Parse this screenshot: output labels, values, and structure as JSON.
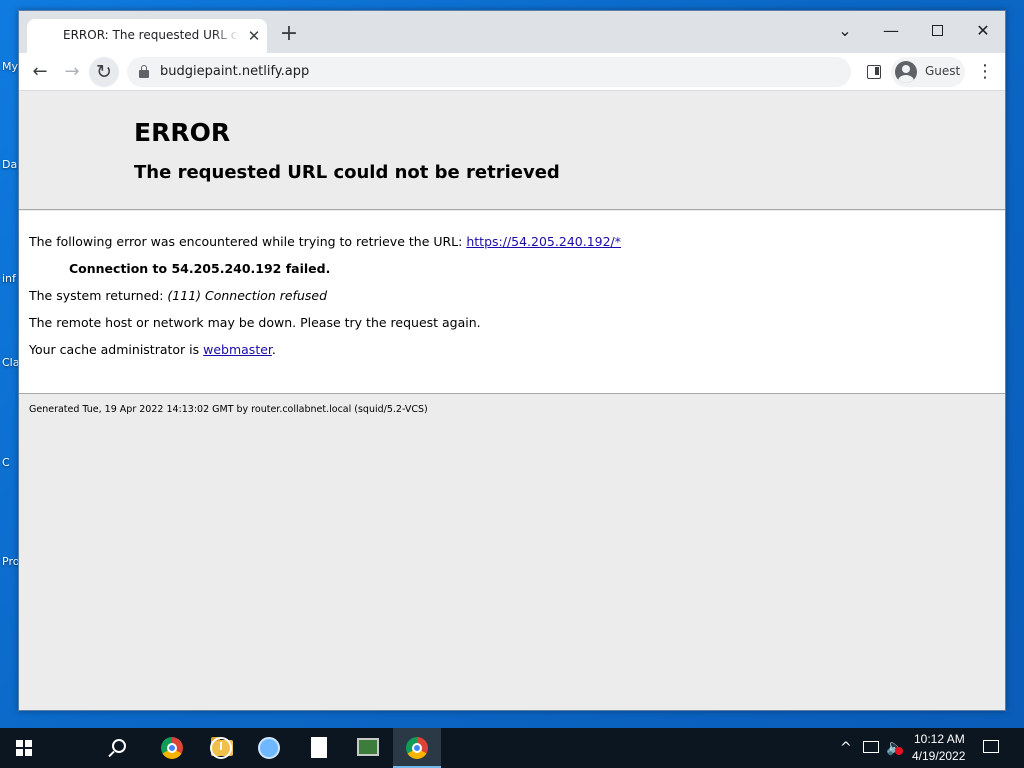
{
  "desktop": {
    "labels": [
      "My",
      "Da",
      "inf",
      "Cla",
      "C",
      "Pro"
    ]
  },
  "browser": {
    "tab_title": "ERROR: The requested URL could not be retrieved",
    "tab_close_glyph": "✕",
    "new_tab_glyph": "+",
    "url": "budgiepaint.netlify.app",
    "profile_label": "Guest",
    "back_glyph": "←",
    "forward_glyph": "→",
    "reload_glyph": "↻",
    "menu_glyph": "⋮",
    "tab_search_glyph": "⌄",
    "minimize_glyph": "—",
    "close_glyph": "✕"
  },
  "page": {
    "title": "ERROR",
    "subtitle": "The requested URL could not be retrieved",
    "line1_prefix": "The following error was encountered while trying to retrieve the URL: ",
    "line1_link": "https://54.205.240.192/*",
    "line2": "Connection to 54.205.240.192 failed.",
    "line3_prefix": "The system returned: ",
    "line3_detail": "(111) Connection refused",
    "line4": "The remote host or network may be down. Please try the request again.",
    "line5_prefix": "Your cache administrator is ",
    "line5_link": "webmaster",
    "line5_suffix": ".",
    "footer": "Generated Tue, 19 Apr 2022 14:13:02 GMT by router.collabnet.local (squid/5.2-VCS)"
  },
  "taskbar": {
    "time": "10:12 AM",
    "date": "4/19/2022",
    "tray_chevron": "^",
    "volume_glyph": "🔈"
  },
  "colors": {
    "desktop_blue": "#0b68c7",
    "link": "#1a0dab",
    "page_gray": "#ececec",
    "taskbar": "#0c1621"
  }
}
